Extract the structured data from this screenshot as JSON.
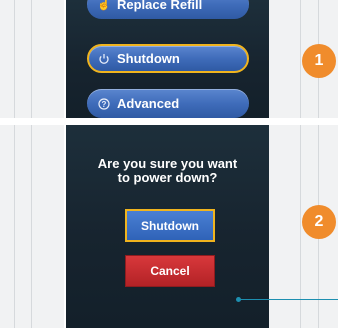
{
  "top_panel": {
    "menu": [
      {
        "label": "Replace Refill",
        "icon": "hand-icon"
      },
      {
        "label": "Shutdown",
        "icon": "power-icon",
        "selected": true
      },
      {
        "label": "Advanced",
        "icon": "question-icon"
      }
    ],
    "step_number": "1"
  },
  "bottom_panel": {
    "prompt_line1": "Are you sure you want",
    "prompt_line2": "to power down?",
    "confirm_label": "Shutdown",
    "cancel_label": "Cancel",
    "step_number": "2"
  },
  "colors": {
    "accent_orange": "#f08c2c",
    "highlight_yellow": "#f0b41e",
    "button_blue": "#3f6cba",
    "cancel_red": "#c92c2f",
    "screen_dark": "#1a2934",
    "callout_teal": "#1d8fb0"
  }
}
